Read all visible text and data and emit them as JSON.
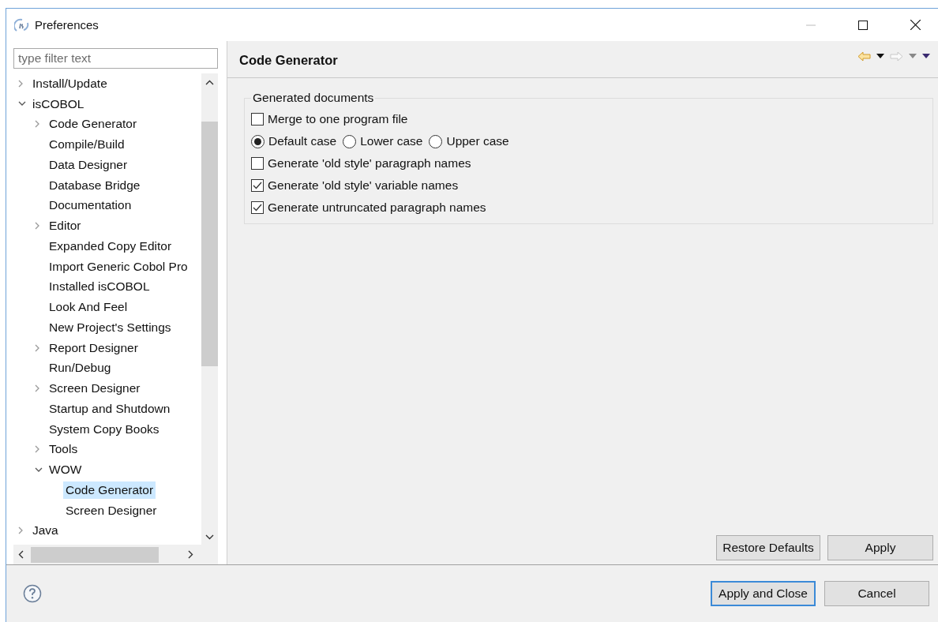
{
  "window": {
    "title": "Preferences"
  },
  "filter": {
    "placeholder": "type filter text"
  },
  "tree": [
    {
      "label": "Install/Update",
      "expanded": false,
      "selected": false
    },
    {
      "label": "isCOBOL",
      "expanded": true,
      "selected": false,
      "children": [
        {
          "label": "Code Generator",
          "expanded": false,
          "selected": false
        },
        {
          "label": "Compile/Build",
          "selected": false
        },
        {
          "label": "Data Designer",
          "selected": false
        },
        {
          "label": "Database Bridge",
          "selected": false
        },
        {
          "label": "Documentation",
          "selected": false
        },
        {
          "label": "Editor",
          "expanded": false,
          "selected": false
        },
        {
          "label": "Expanded Copy Editor",
          "selected": false
        },
        {
          "label": "Import Generic Cobol Pro",
          "selected": false
        },
        {
          "label": "Installed isCOBOL",
          "selected": false
        },
        {
          "label": "Look And Feel",
          "selected": false
        },
        {
          "label": "New Project's Settings",
          "selected": false
        },
        {
          "label": "Report Designer",
          "expanded": false,
          "selected": false
        },
        {
          "label": "Run/Debug",
          "selected": false
        },
        {
          "label": "Screen Designer",
          "expanded": false,
          "selected": false
        },
        {
          "label": "Startup and Shutdown",
          "selected": false
        },
        {
          "label": "System Copy Books",
          "selected": false
        },
        {
          "label": "Tools",
          "expanded": false,
          "selected": false
        },
        {
          "label": "WOW",
          "expanded": true,
          "selected": false,
          "children": [
            {
              "label": "Code Generator",
              "selected": true
            },
            {
              "label": "Screen Designer",
              "selected": false
            }
          ]
        }
      ]
    },
    {
      "label": "Java",
      "expanded": false,
      "selected": false
    }
  ],
  "page": {
    "title": "Code Generator",
    "group": {
      "title": "Generated documents",
      "options": [
        {
          "kind": "checkbox",
          "label": "Merge to one program file",
          "checked": false
        },
        {
          "kind": "radio_group",
          "choices": [
            {
              "label": "Default case",
              "selected": true
            },
            {
              "label": "Lower case",
              "selected": false
            },
            {
              "label": "Upper case",
              "selected": false
            }
          ]
        },
        {
          "kind": "checkbox",
          "label": "Generate 'old style' paragraph names",
          "checked": false
        },
        {
          "kind": "checkbox",
          "label": "Generate 'old style' variable names",
          "checked": true
        },
        {
          "kind": "checkbox",
          "label": "Generate untruncated paragraph names",
          "checked": true
        }
      ]
    },
    "buttons": [
      {
        "label": "Restore Defaults"
      },
      {
        "label": "Apply"
      }
    ]
  },
  "footer": {
    "buttons": [
      {
        "label": "Apply and Close",
        "default": true
      },
      {
        "label": "Cancel",
        "default": false
      }
    ]
  }
}
